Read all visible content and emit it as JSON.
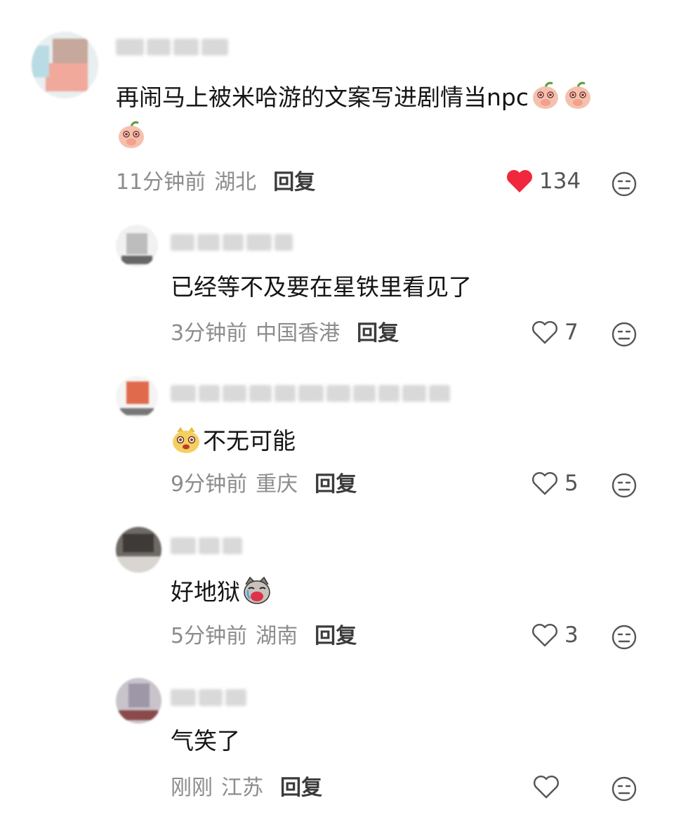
{
  "comments": [
    {
      "text": "再闹马上被米哈游的文案写进剧情当npc",
      "time": "11分钟前",
      "location": "湖北",
      "reply_label": "回复",
      "likes": "134",
      "liked": true,
      "emojis": [
        "peach-cover-mouth-emoji",
        "peach-cover-mouth-emoji",
        "peach-cover-mouth-emoji"
      ]
    },
    {
      "text": "已经等不及要在星铁里看见了",
      "time": "3分钟前",
      "location": "中国香港",
      "reply_label": "回复",
      "likes": "7",
      "liked": false
    },
    {
      "text": "不无可能",
      "time": "9分钟前",
      "location": "重庆",
      "reply_label": "回复",
      "likes": "5",
      "liked": false,
      "emojis": [
        "yellow-bear-emoji"
      ]
    },
    {
      "text": "好地狱",
      "time": "5分钟前",
      "location": "湖南",
      "reply_label": "回复",
      "likes": "3",
      "liked": false,
      "emojis": [
        "crying-cat-emoji"
      ]
    },
    {
      "text": "气笑了",
      "time": "刚刚",
      "location": "江苏",
      "reply_label": "回复",
      "likes": "",
      "liked": false
    }
  ],
  "colors": {
    "liked_heart": "#f0273d",
    "meta_text": "#8c8c8c",
    "reply_text": "#3b3b3b",
    "icon_gray": "#555555"
  },
  "icons": {
    "like": "heart-icon",
    "dislike": "dislike-face-icon"
  }
}
